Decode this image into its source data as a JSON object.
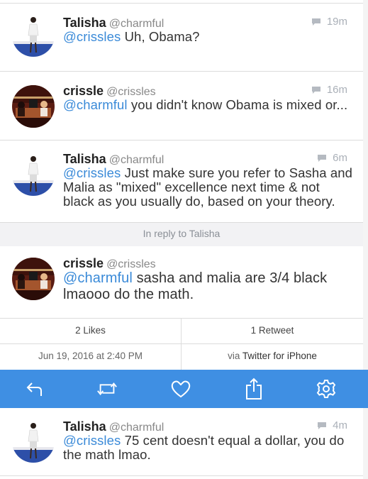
{
  "tweets": [
    {
      "name": "Talisha",
      "handle": "@charmful",
      "time": "19m",
      "mention": "@crissles",
      "text": " Uh, Obama?"
    },
    {
      "name": "crissle",
      "handle": "@crissles",
      "time": "16m",
      "mention": "@charmful",
      "text": " you didn't know Obama is mixed or..."
    },
    {
      "name": "Talisha",
      "handle": "@charmful",
      "time": "6m",
      "mention": "@crissles",
      "text": " Just make sure you refer to Sasha and Malia as \"mixed\" excellence next time & not black as you usually do, based on your theory."
    }
  ],
  "reply_banner": "In reply to Talisha",
  "focused": {
    "name": "crissle",
    "handle": "@crissles",
    "mention": "@charmful",
    "text": " sasha and malia are 3/4 black lmaooo do the math."
  },
  "stats": {
    "likes": "2 Likes",
    "retweets": "1 Retweet",
    "date": "Jun 19, 2016 at 2:40 PM",
    "via_prefix": "via ",
    "via_app": "Twitter for iPhone"
  },
  "toolbar_icons": [
    "reply-icon",
    "retweet-icon",
    "like-icon",
    "share-icon",
    "settings-icon"
  ],
  "last_tweet": {
    "name": "Talisha",
    "handle": "@charmful",
    "time": "4m",
    "mention": "@crissles",
    "text": " 75 cent doesn't equal a dollar, you do the math lmao."
  },
  "colors": {
    "accent": "#3f8fe3",
    "mention": "#3a8ad8",
    "meta": "#aab0b8"
  }
}
